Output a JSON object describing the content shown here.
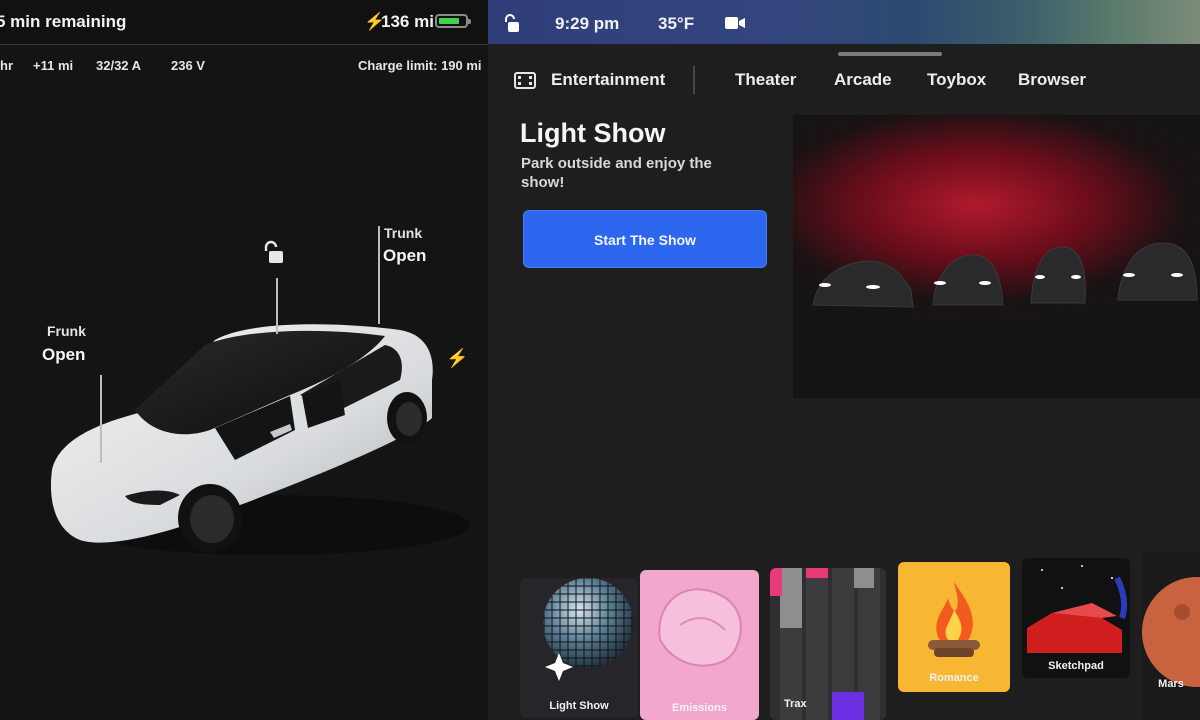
{
  "left_panel": {
    "charge": {
      "remaining": "5 min remaining",
      "range": "136 mi",
      "battery_fill_fraction": 0.8
    },
    "stats": [
      "hr",
      "+11 mi",
      "32/32 A",
      "236 V"
    ],
    "charge_limit": "Charge limit: 190 mi",
    "frunk": {
      "title": "Frunk",
      "value": "Open"
    },
    "trunk": {
      "title": "Trunk",
      "value": "Open"
    }
  },
  "status_bar": {
    "time": "9:29 pm",
    "temperature": "35°F"
  },
  "nav": {
    "current": "Entertainment",
    "items": [
      "Theater",
      "Arcade",
      "Toybox",
      "Browser"
    ]
  },
  "hero": {
    "title": "Light Show",
    "description": "Park outside and enjoy the show!",
    "button": "Start The Show"
  },
  "tiles": [
    {
      "label": "Light Show",
      "icon": "disco-ball-icon"
    },
    {
      "label": "Emissions",
      "icon": "cushion-icon"
    },
    {
      "label": "Trax",
      "icon": "piano-roll-icon"
    },
    {
      "label": "Romance",
      "icon": "fireplace-icon"
    },
    {
      "label": "Sketchpad",
      "icon": "sketch-car-icon"
    },
    {
      "label": "Mars",
      "icon": "planet-icon"
    }
  ],
  "colors": {
    "accent_button": "#2d67f0",
    "charge_green": "#3ed44f"
  }
}
